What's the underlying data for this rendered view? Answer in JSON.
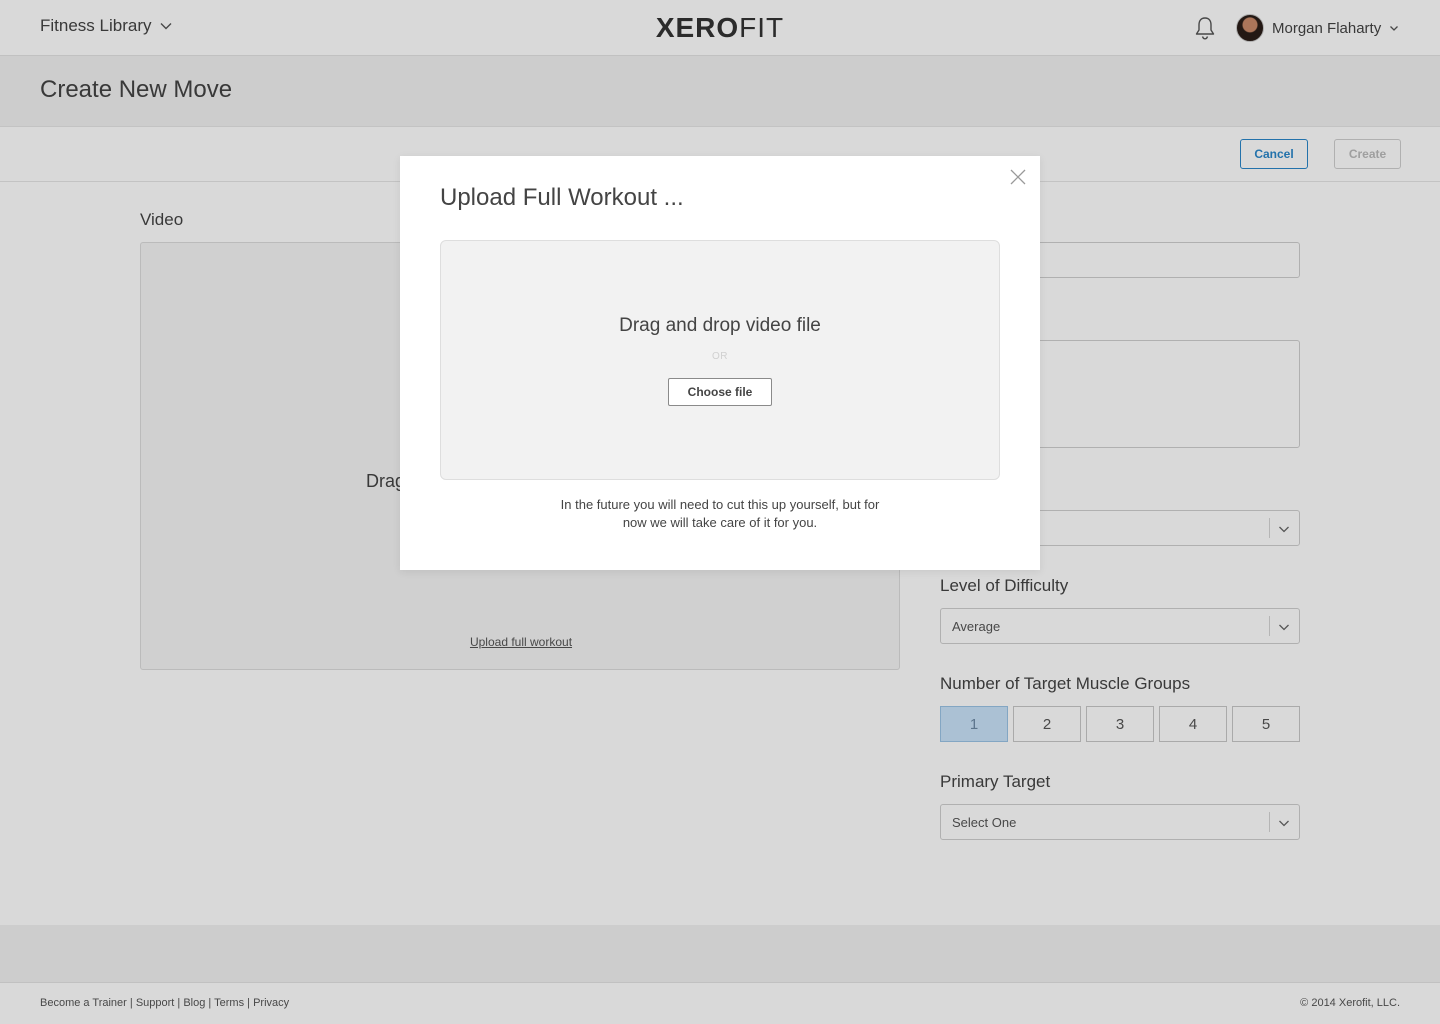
{
  "header": {
    "nav_title": "Fitness Library",
    "logo_bold": "XERO",
    "logo_light": "FIT",
    "user_name": "Morgan Flaharty"
  },
  "page": {
    "title": "Create New Move"
  },
  "actions": {
    "cancel_label": "Cancel",
    "create_label": "Create"
  },
  "video": {
    "label": "Video",
    "drop_text_partial": "Drag",
    "upload_link": "Upload full workout"
  },
  "form": {
    "difficulty_label": "Level of Difficulty",
    "difficulty_value": "Average",
    "muscle_groups_label": "Number of Target Muscle Groups",
    "muscle_groups_options": [
      "1",
      "2",
      "3",
      "4",
      "5"
    ],
    "muscle_groups_selected": "1",
    "primary_target_label": "Primary Target",
    "primary_target_value": "Select One"
  },
  "modal": {
    "title": "Upload Full Workout ...",
    "drop_title": "Drag and drop video file",
    "or_label": "OR",
    "choose_file_label": "Choose file",
    "note_line1": "In the future you will need to cut this up yourself, but for",
    "note_line2": "now we will take care of it for you."
  },
  "footer": {
    "links": [
      "Become a Trainer",
      "Support",
      "Blog",
      "Terms",
      "Privacy"
    ],
    "copyright": "© 2014 Xerofit, LLC."
  },
  "colors": {
    "accent": "#2a87c9",
    "selected_bg": "#c9e3fa",
    "overlay": "rgba(0,0,0,0.15)"
  },
  "icons": [
    "chevron-down-icon",
    "bell-icon",
    "avatar",
    "close-icon"
  ]
}
